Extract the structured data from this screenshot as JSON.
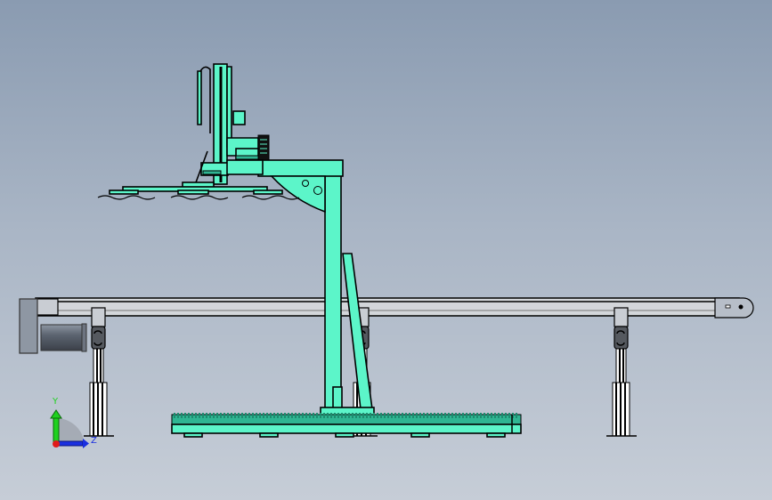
{
  "viewport": {
    "colors": {
      "part": "#5cf5c9",
      "background_top": "#8a9bb1",
      "background_bottom": "#c6cdd7"
    }
  },
  "triad": {
    "y_label": "Y",
    "z_label": "Z",
    "y_color": "#1fd11f",
    "z_color": "#1a2fe0",
    "x_color": "#e01a1a"
  }
}
